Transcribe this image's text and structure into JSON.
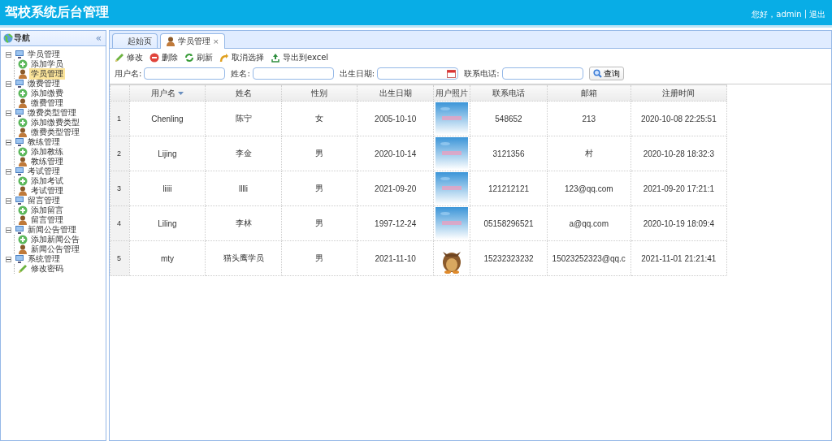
{
  "header": {
    "title": "驾校系统后台管理",
    "greeting": "您好，admin",
    "separator": "|",
    "logout": "退出"
  },
  "sidebar": {
    "title": "导航",
    "collapse": "«",
    "items": [
      {
        "label": "学员管理",
        "expanded": true,
        "children": [
          {
            "label": "添加学员",
            "kind": "add",
            "selected": false
          },
          {
            "label": "学员管理",
            "kind": "manage",
            "selected": true
          }
        ]
      },
      {
        "label": "缴费管理",
        "expanded": true,
        "children": [
          {
            "label": "添加缴费",
            "kind": "add",
            "selected": false
          },
          {
            "label": "缴费管理",
            "kind": "manage",
            "selected": false
          }
        ]
      },
      {
        "label": "缴费类型管理",
        "expanded": true,
        "children": [
          {
            "label": "添加缴费类型",
            "kind": "add",
            "selected": false
          },
          {
            "label": "缴费类型管理",
            "kind": "manage",
            "selected": false
          }
        ]
      },
      {
        "label": "教练管理",
        "expanded": true,
        "children": [
          {
            "label": "添加教练",
            "kind": "add",
            "selected": false
          },
          {
            "label": "教练管理",
            "kind": "manage",
            "selected": false
          }
        ]
      },
      {
        "label": "考试管理",
        "expanded": true,
        "children": [
          {
            "label": "添加考试",
            "kind": "add",
            "selected": false
          },
          {
            "label": "考试管理",
            "kind": "manage",
            "selected": false
          }
        ]
      },
      {
        "label": "留言管理",
        "expanded": true,
        "children": [
          {
            "label": "添加留言",
            "kind": "add",
            "selected": false
          },
          {
            "label": "留言管理",
            "kind": "manage",
            "selected": false
          }
        ]
      },
      {
        "label": "新闻公告管理",
        "expanded": true,
        "children": [
          {
            "label": "添加新闻公告",
            "kind": "add",
            "selected": false
          },
          {
            "label": "新闻公告管理",
            "kind": "manage",
            "selected": false
          }
        ]
      },
      {
        "label": "系统管理",
        "expanded": true,
        "children": [
          {
            "label": "修改密码",
            "kind": "edit",
            "selected": false
          }
        ]
      }
    ]
  },
  "tabs": [
    {
      "label": "起始页",
      "kind": "plain",
      "selected": false
    },
    {
      "label": "学员管理",
      "kind": "person",
      "selected": true,
      "close": "×"
    }
  ],
  "toolbar": [
    {
      "label": "修改",
      "kind": "edit"
    },
    {
      "label": "删除",
      "kind": "delete"
    },
    {
      "label": "刷新",
      "kind": "refresh"
    },
    {
      "label": "取消选择",
      "kind": "undo"
    },
    {
      "label": "导出到excel",
      "kind": "export"
    }
  ],
  "search": {
    "fields": [
      {
        "label": "用户名:",
        "kind": "text"
      },
      {
        "label": "姓名:",
        "kind": "text"
      },
      {
        "label": "出生日期:",
        "kind": "date"
      },
      {
        "label": "联系电话:",
        "kind": "text"
      }
    ],
    "button": "查询"
  },
  "table": {
    "columns": [
      {
        "label": "用户名",
        "sorted": true
      },
      {
        "label": "姓名",
        "sorted": false
      },
      {
        "label": "性别",
        "sorted": false
      },
      {
        "label": "出生日期",
        "sorted": false
      },
      {
        "label": "用户照片",
        "sorted": false
      },
      {
        "label": "联系电话",
        "sorted": false
      },
      {
        "label": "邮箱",
        "sorted": false
      },
      {
        "label": "注册时间",
        "sorted": false
      }
    ],
    "rows": [
      {
        "index": "1",
        "cells": [
          "Chenling",
          "陈宁",
          "女",
          "2005-10-10",
          {
            "kind": "picture"
          },
          "548652",
          "213",
          "2020-10-08 22:25:51"
        ]
      },
      {
        "index": "2",
        "cells": [
          "Lijing",
          "李金",
          "男",
          "2020-10-14",
          {
            "kind": "picture"
          },
          "3121356",
          "村",
          "2020-10-28 18:32:3"
        ]
      },
      {
        "index": "3",
        "cells": [
          "liiii",
          "lllli",
          "男",
          "2021-09-20",
          {
            "kind": "picture"
          },
          "121212121",
          "123@qq.com",
          "2021-09-20 17:21:1"
        ]
      },
      {
        "index": "4",
        "cells": [
          "Liling",
          "李林",
          "男",
          "1997-12-24",
          {
            "kind": "picture"
          },
          "05158296521",
          "a@qq.com",
          "2020-10-19 18:09:4"
        ]
      },
      {
        "index": "5",
        "cells": [
          "mty",
          "猫头鹰学员",
          "男",
          "2021-11-10",
          {
            "kind": "picture"
          },
          "15232323232",
          "15023252323@qq.c",
          "2021-11-01 21:21:41"
        ]
      }
    ]
  }
}
